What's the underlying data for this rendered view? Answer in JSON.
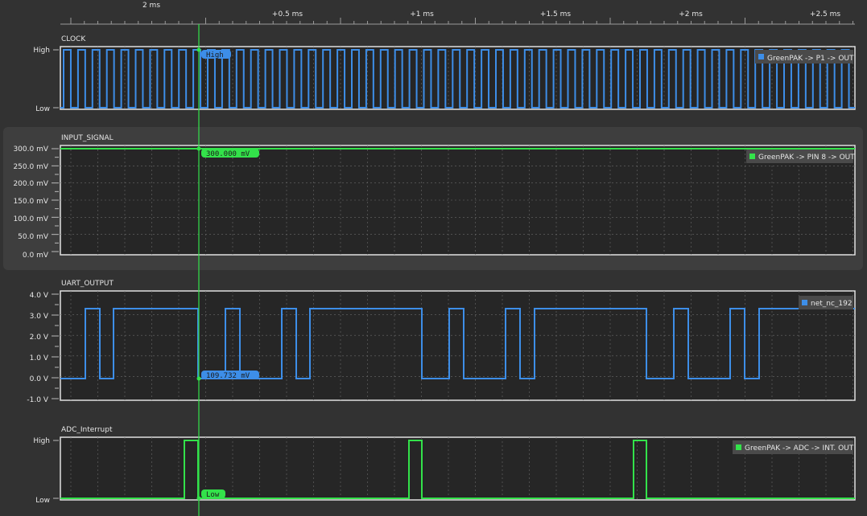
{
  "time_axis": {
    "start_label": "2 ms",
    "ticks": [
      "+0.5 ms",
      "+1 ms",
      "+1.5 ms",
      "+2 ms",
      "+2.5 ms"
    ]
  },
  "cursor": {
    "time_ms_offset": 0.17
  },
  "panels": [
    {
      "title": "CLOCK",
      "kind": "digital",
      "y_labels": [
        "High",
        "Low"
      ],
      "legend": "GreenPAK -> P1 -> OUT",
      "color": "#3d8ee8",
      "cursor_value": "High"
    },
    {
      "title": "INPUT_SIGNAL",
      "kind": "analog",
      "y_labels": [
        "300.0 mV",
        "250.0 mV",
        "200.0 mV",
        "150.0 mV",
        "100.0 mV",
        "50.0 mV",
        "0.0 mV"
      ],
      "legend": "GreenPAK -> PIN 8 -> OUT",
      "color": "#33e24a",
      "cursor_value": "300.000 mV",
      "level_mv": 300
    },
    {
      "title": "UART_OUTPUT",
      "kind": "analog",
      "y_labels": [
        "4.0 V",
        "3.0 V",
        "2.0 V",
        "1.0 V",
        "0.0 V",
        "-1.0 V"
      ],
      "legend": "net_nc_192",
      "color": "#3d8ee8",
      "cursor_value": "109.732 mV",
      "high_v": 3.3,
      "low_v": 0
    },
    {
      "title": "ADC_Interrupt",
      "kind": "digital",
      "y_labels": [
        "High",
        "Low"
      ],
      "legend": "GreenPAK -> ADC -> INT. OUT",
      "color": "#33e24a",
      "cursor_value": "Low"
    }
  ]
}
